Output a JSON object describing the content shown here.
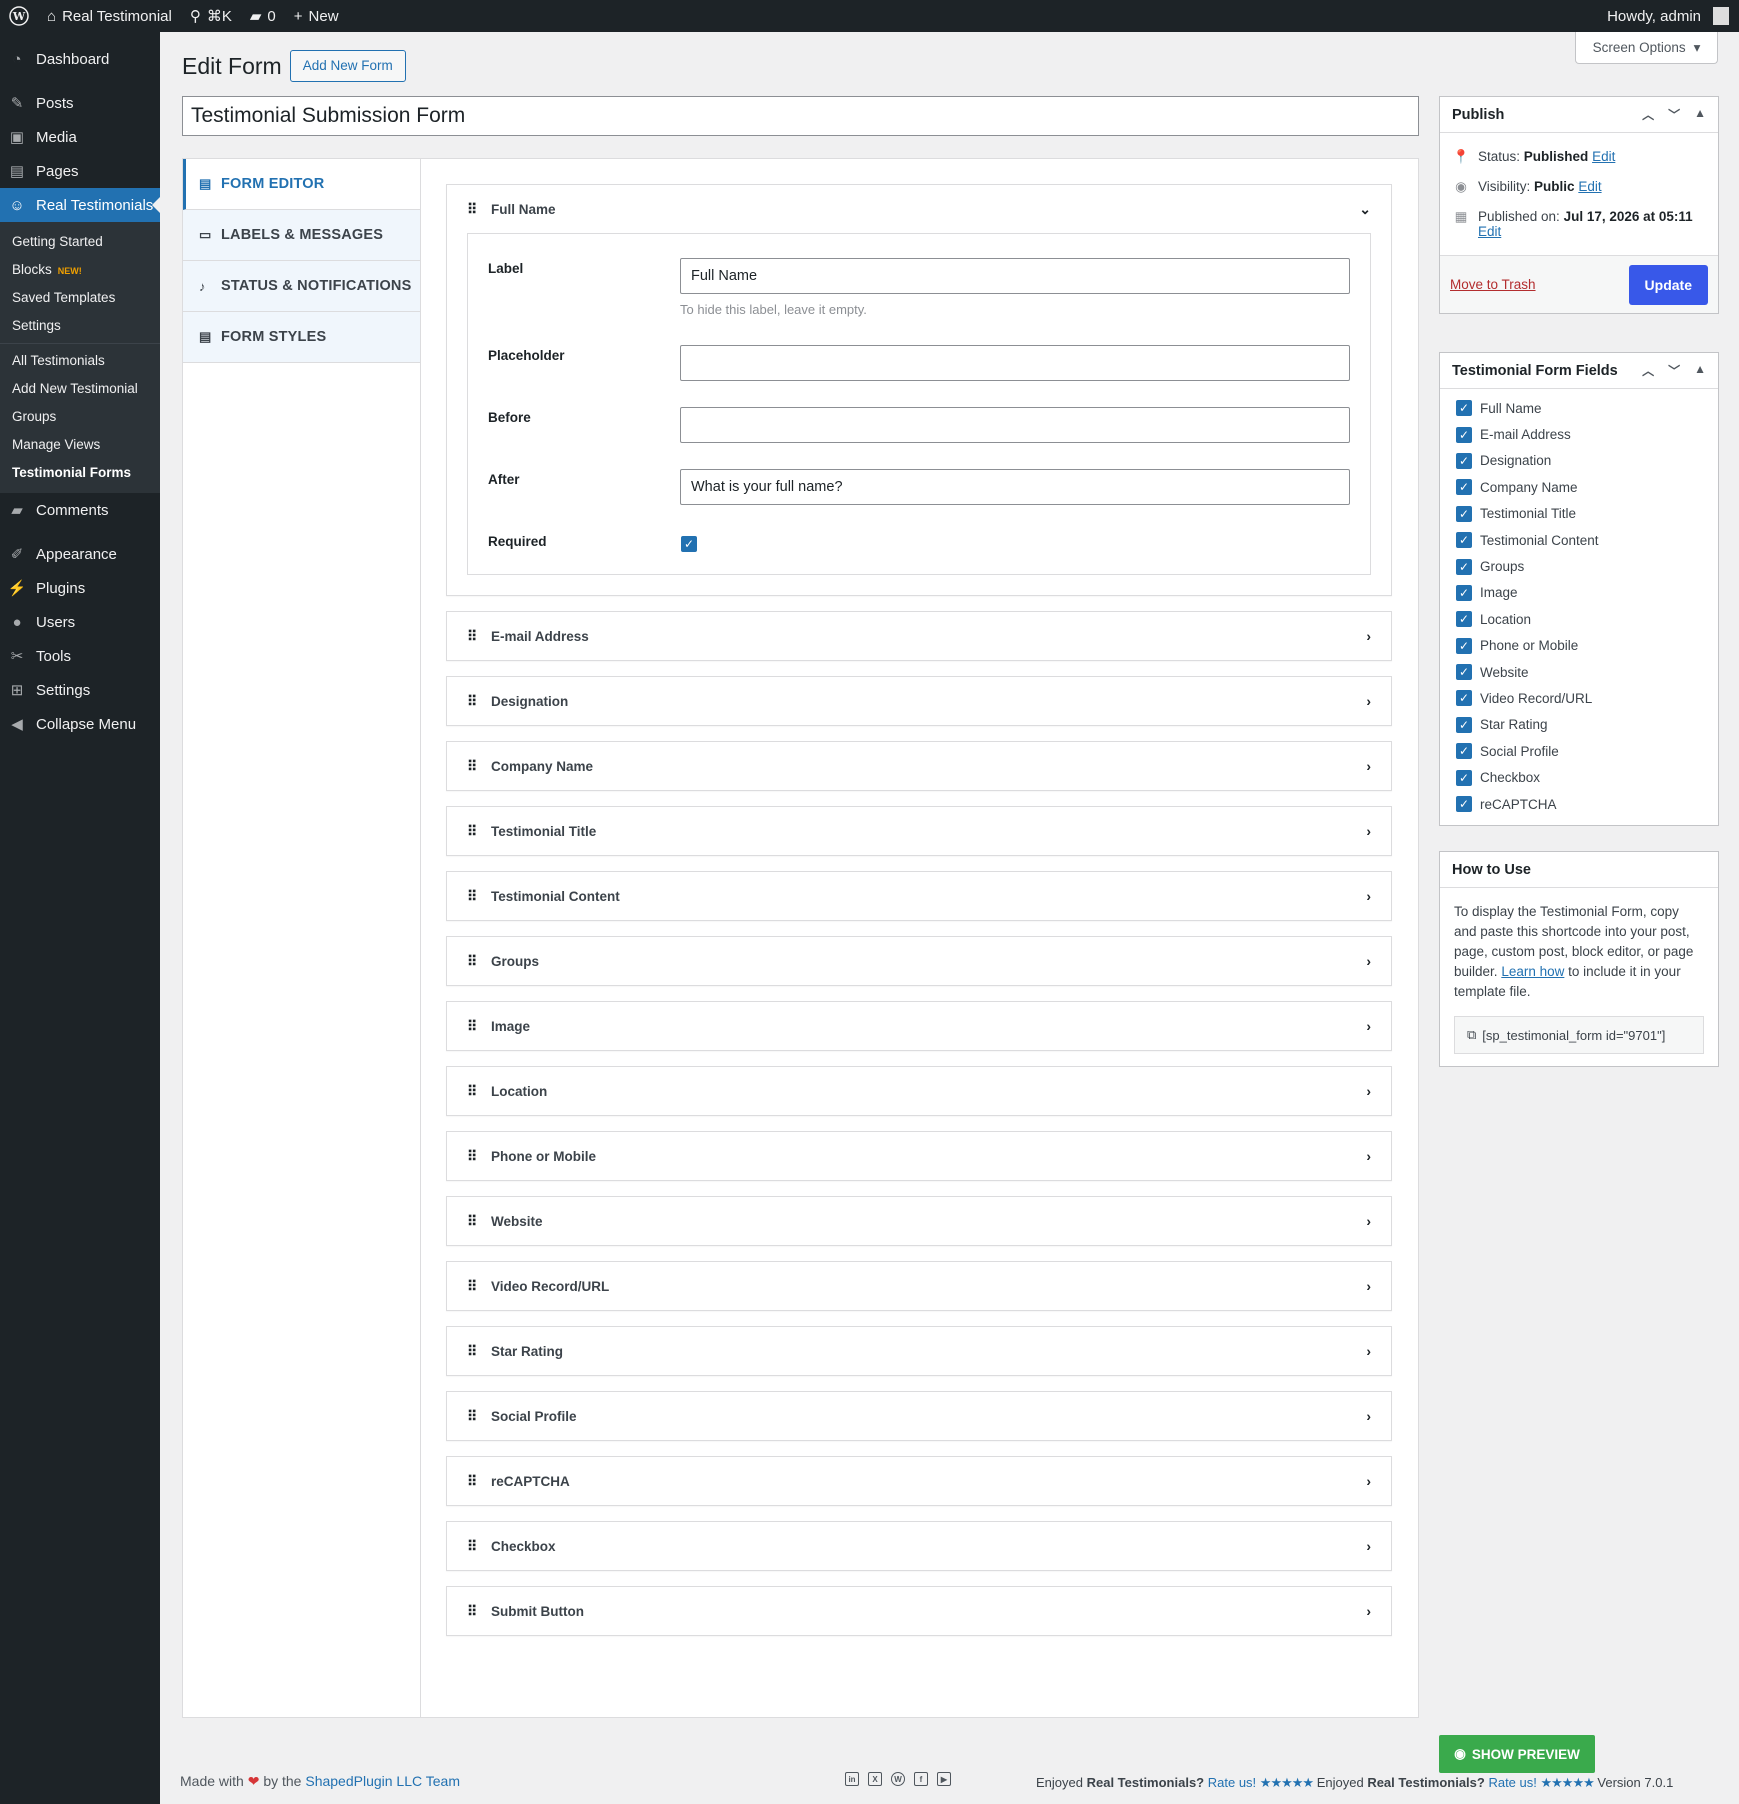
{
  "adminbar": {
    "site_name": "Real Testimonial",
    "search_shortcut": "⌘K",
    "comments_count": "0",
    "new_label": "New",
    "howdy": "Howdy, admin"
  },
  "sidebar": {
    "dashboard": "Dashboard",
    "posts": "Posts",
    "media": "Media",
    "pages": "Pages",
    "real_testimonials": "Real Testimonials",
    "sub": {
      "getting_started": "Getting Started",
      "blocks": "Blocks",
      "blocks_badge": "NEW!",
      "saved_templates": "Saved Templates",
      "settings": "Settings",
      "all_testimonials": "All Testimonials",
      "add_new_testimonial": "Add New Testimonial",
      "groups": "Groups",
      "manage_views": "Manage Views",
      "testimonial_forms": "Testimonial Forms"
    },
    "comments": "Comments",
    "appearance": "Appearance",
    "plugins": "Plugins",
    "users": "Users",
    "tools": "Tools",
    "settings": "Settings",
    "collapse": "Collapse Menu"
  },
  "header": {
    "title": "Edit Form",
    "add_new": "Add New Form",
    "screen_options": "Screen Options"
  },
  "post_title": "Testimonial Submission Form",
  "tabs": [
    "FORM EDITOR",
    "LABELS & MESSAGES",
    "STATUS & NOTIFICATIONS",
    "FORM STYLES"
  ],
  "expanded_field": {
    "name": "Full Name",
    "label_label": "Label",
    "label_value": "Full Name",
    "label_help": "To hide this label, leave it empty.",
    "placeholder_label": "Placeholder",
    "placeholder_value": "",
    "before_label": "Before",
    "before_value": "",
    "after_label": "After",
    "after_value": "What is your full name?",
    "required_label": "Required",
    "required_checked": true
  },
  "collapsed_fields": [
    "E-mail Address",
    "Designation",
    "Company Name",
    "Testimonial Title",
    "Testimonial Content",
    "Groups",
    "Image",
    "Location",
    "Phone or Mobile",
    "Website",
    "Video Record/URL",
    "Star Rating",
    "Social Profile",
    "reCAPTCHA",
    "Checkbox",
    "Submit Button"
  ],
  "publish": {
    "title": "Publish",
    "status_label": "Status:",
    "status_value": "Published",
    "visibility_label": "Visibility:",
    "visibility_value": "Public",
    "published_label": "Published on:",
    "published_value": "Jul 17, 2026 at 05:11",
    "edit": "Edit",
    "trash": "Move to Trash",
    "update": "Update"
  },
  "form_fields_box": {
    "title": "Testimonial Form Fields",
    "items": [
      "Full Name",
      "E-mail Address",
      "Designation",
      "Company Name",
      "Testimonial Title",
      "Testimonial Content",
      "Groups",
      "Image",
      "Location",
      "Phone or Mobile",
      "Website",
      "Video Record/URL",
      "Star Rating",
      "Social Profile",
      "Checkbox",
      "reCAPTCHA"
    ]
  },
  "howto": {
    "title": "How to Use",
    "text_before": "To display the Testimonial Form, copy and paste this shortcode into your post, page, custom post, block editor, or page builder.",
    "learn_how": "Learn how",
    "text_after": "to include it in your template file.",
    "shortcode": "[sp_testimonial_form id=\"9701\"]"
  },
  "footer": {
    "show_preview": "SHOW PREVIEW",
    "made_with": "Made with",
    "by_the": "by the",
    "team": "ShapedPlugin LLC Team",
    "enjoyed": "Enjoyed",
    "plugin_name": "Real Testimonials?",
    "rate_us": "Rate us!",
    "stars": "★★★★★",
    "version": "Version 7.0.1"
  },
  "colors": {
    "accent": "#2271b1",
    "update_button": "#3858e9",
    "preview_button": "#3aaa4c",
    "sidebar_bg": "#1d2327"
  }
}
